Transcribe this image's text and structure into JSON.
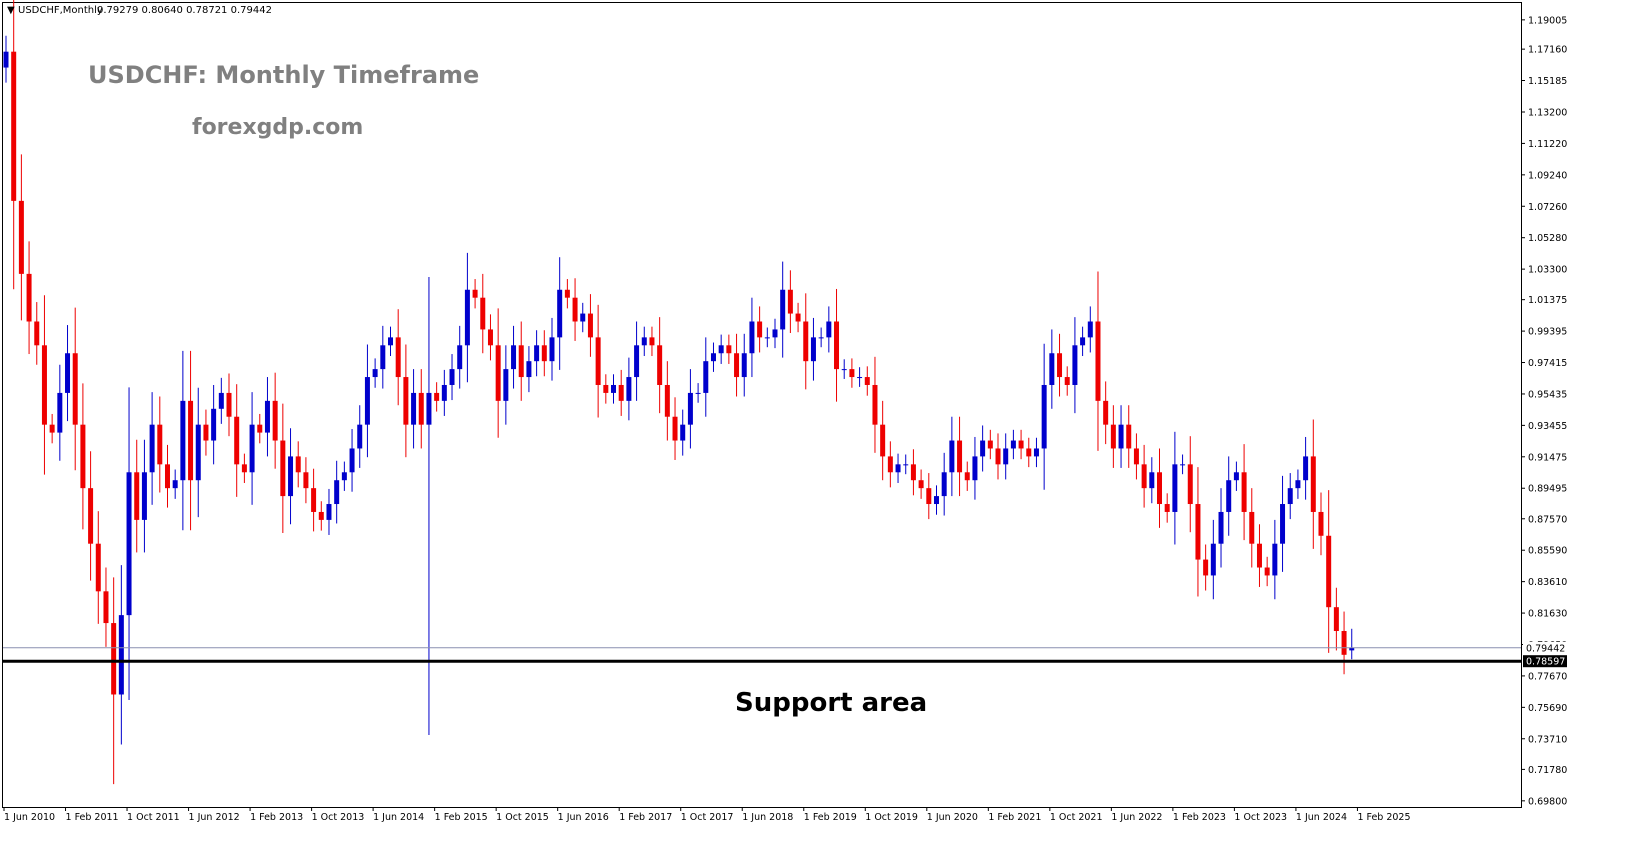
{
  "header": {
    "symbol": "USDCHF,Monthly",
    "ohlc": "0.79279 0.80640 0.78721 0.79442"
  },
  "watermark": {
    "title": "USDCHF: Monthly Timeframe",
    "site": "forexgdp.com"
  },
  "annotation": {
    "support_label": "Support area",
    "support_level": 0.78597
  },
  "colors": {
    "bull": "#0000cc",
    "bear": "#ee0000",
    "support_line": "#000000",
    "current_price_line": "#8a8fb0"
  },
  "chart_data": {
    "type": "candlestick",
    "symbol": "USDCHF",
    "timeframe": "Monthly",
    "ylim": [
      0.696,
      1.195
    ],
    "y_ticks": [
      "1.19005",
      "1.17160",
      "1.15185",
      "1.13200",
      "1.11220",
      "1.09240",
      "1.07260",
      "1.05280",
      "1.03300",
      "1.01375",
      "0.99395",
      "0.97415",
      "0.95435",
      "0.93455",
      "0.91475",
      "0.89495",
      "0.87570",
      "0.85590",
      "0.83610",
      "0.81630",
      "0.79650",
      "0.77670",
      "0.75690",
      "0.73710",
      "0.71780",
      "0.69800"
    ],
    "x_ticks": [
      {
        "label": "1 Jun 2010",
        "month": 0
      },
      {
        "label": "1 Feb 2011",
        "month": 8
      },
      {
        "label": "1 Oct 2011",
        "month": 16
      },
      {
        "label": "1 Jun 2012",
        "month": 24
      },
      {
        "label": "1 Feb 2013",
        "month": 32
      },
      {
        "label": "1 Oct 2013",
        "month": 40
      },
      {
        "label": "1 Jun 2014",
        "month": 48
      },
      {
        "label": "1 Feb 2015",
        "month": 56
      },
      {
        "label": "1 Oct 2015",
        "month": 64
      },
      {
        "label": "1 Jun 2016",
        "month": 72
      },
      {
        "label": "1 Feb 2017",
        "month": 80
      },
      {
        "label": "1 Oct 2017",
        "month": 88
      },
      {
        "label": "1 Jun 2018",
        "month": 96
      },
      {
        "label": "1 Feb 2019",
        "month": 104
      },
      {
        "label": "1 Oct 2019",
        "month": 112
      },
      {
        "label": "1 Jun 2020",
        "month": 120
      },
      {
        "label": "1 Feb 2021",
        "month": 128
      },
      {
        "label": "1 Oct 2021",
        "month": 136
      },
      {
        "label": "1 Jun 2022",
        "month": 144
      },
      {
        "label": "1 Feb 2023",
        "month": 152
      },
      {
        "label": "1 Oct 2023",
        "month": 160
      },
      {
        "label": "1 Jun 2024",
        "month": 168
      },
      {
        "label": "1 Feb 2025",
        "month": 176
      }
    ],
    "current_price": 0.79442,
    "support_price": 0.78597,
    "closes": [
      1.17,
      1.076,
      1.03,
      1.0,
      0.985,
      0.935,
      0.93,
      0.955,
      0.98,
      0.935,
      0.895,
      0.86,
      0.83,
      0.81,
      0.765,
      0.815,
      0.905,
      0.875,
      0.905,
      0.935,
      0.91,
      0.895,
      0.9,
      0.95,
      0.9,
      0.935,
      0.925,
      0.945,
      0.955,
      0.94,
      0.91,
      0.905,
      0.935,
      0.93,
      0.95,
      0.925,
      0.89,
      0.915,
      0.905,
      0.895,
      0.88,
      0.875,
      0.885,
      0.9,
      0.905,
      0.92,
      0.935,
      0.965,
      0.97,
      0.985,
      0.99,
      0.965,
      0.935,
      0.955,
      0.935,
      0.955,
      0.95,
      0.96,
      0.97,
      0.985,
      1.02,
      1.015,
      0.995,
      0.985,
      0.95,
      0.97,
      0.985,
      0.965,
      0.975,
      0.985,
      0.975,
      0.99,
      1.02,
      1.015,
      1.0,
      1.005,
      0.99,
      0.96,
      0.955,
      0.96,
      0.95,
      0.965,
      0.985,
      0.99,
      0.985,
      0.96,
      0.94,
      0.925,
      0.935,
      0.955,
      0.955,
      0.975,
      0.98,
      0.985,
      0.98,
      0.965,
      0.98,
      1.0,
      0.99,
      0.99,
      0.995,
      1.02,
      1.005,
      1.0,
      0.975,
      0.99,
      0.99,
      1.0,
      0.97,
      0.97,
      0.965,
      0.965,
      0.96,
      0.935,
      0.915,
      0.905,
      0.91,
      0.91,
      0.9,
      0.895,
      0.885,
      0.89,
      0.905,
      0.925,
      0.905,
      0.9,
      0.915,
      0.925,
      0.92,
      0.91,
      0.92,
      0.925,
      0.92,
      0.915,
      0.92,
      0.96,
      0.98,
      0.965,
      0.96,
      0.985,
      0.99,
      1.0,
      0.95,
      0.935,
      0.92,
      0.935,
      0.92,
      0.91,
      0.895,
      0.905,
      0.885,
      0.88,
      0.91,
      0.91,
      0.885,
      0.85,
      0.84,
      0.86,
      0.88,
      0.9,
      0.905,
      0.88,
      0.86,
      0.845,
      0.84,
      0.86,
      0.885,
      0.895,
      0.9,
      0.915,
      0.88,
      0.865,
      0.82,
      0.805,
      0.79,
      0.79442
    ],
    "opens": [
      1.16,
      1.17,
      1.076,
      1.03,
      1.0,
      0.985,
      0.935,
      0.93,
      0.955,
      0.98,
      0.935,
      0.895,
      0.86,
      0.83,
      0.81,
      0.765,
      0.815,
      0.905,
      0.875,
      0.905,
      0.935,
      0.91,
      0.895,
      0.9,
      0.95,
      0.9,
      0.935,
      0.925,
      0.945,
      0.955,
      0.94,
      0.91,
      0.905,
      0.935,
      0.93,
      0.95,
      0.925,
      0.89,
      0.915,
      0.905,
      0.895,
      0.88,
      0.875,
      0.885,
      0.9,
      0.905,
      0.92,
      0.935,
      0.965,
      0.97,
      0.985,
      0.99,
      0.965,
      0.935,
      0.955,
      0.935,
      0.955,
      0.95,
      0.96,
      0.97,
      0.985,
      1.02,
      1.015,
      0.995,
      0.985,
      0.95,
      0.97,
      0.985,
      0.965,
      0.975,
      0.985,
      0.975,
      0.99,
      1.02,
      1.015,
      1.0,
      1.005,
      0.99,
      0.96,
      0.955,
      0.96,
      0.95,
      0.965,
      0.985,
      0.99,
      0.985,
      0.96,
      0.94,
      0.925,
      0.935,
      0.955,
      0.955,
      0.975,
      0.98,
      0.985,
      0.98,
      0.965,
      0.98,
      1.0,
      0.99,
      0.99,
      0.995,
      1.02,
      1.005,
      1.0,
      0.975,
      0.99,
      0.99,
      1.0,
      0.97,
      0.97,
      0.965,
      0.965,
      0.96,
      0.935,
      0.915,
      0.905,
      0.91,
      0.91,
      0.9,
      0.895,
      0.885,
      0.89,
      0.905,
      0.925,
      0.905,
      0.9,
      0.915,
      0.925,
      0.92,
      0.91,
      0.92,
      0.925,
      0.92,
      0.915,
      0.92,
      0.96,
      0.98,
      0.965,
      0.96,
      0.985,
      0.99,
      1.0,
      0.95,
      0.935,
      0.92,
      0.935,
      0.92,
      0.91,
      0.895,
      0.905,
      0.885,
      0.88,
      0.91,
      0.91,
      0.885,
      0.85,
      0.84,
      0.86,
      0.88,
      0.9,
      0.905,
      0.88,
      0.86,
      0.845,
      0.84,
      0.86,
      0.885,
      0.895,
      0.9,
      0.915,
      0.88,
      0.865,
      0.82,
      0.805,
      0.79279
    ]
  }
}
